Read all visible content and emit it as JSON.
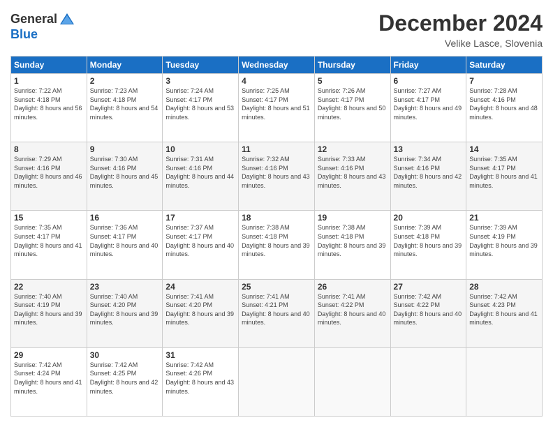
{
  "logo": {
    "general": "General",
    "blue": "Blue"
  },
  "header": {
    "month": "December 2024",
    "location": "Velike Lasce, Slovenia"
  },
  "weekdays": [
    "Sunday",
    "Monday",
    "Tuesday",
    "Wednesday",
    "Thursday",
    "Friday",
    "Saturday"
  ],
  "weeks": [
    [
      {
        "day": "1",
        "info": "Sunrise: 7:22 AM\nSunset: 4:18 PM\nDaylight: 8 hours and 56 minutes."
      },
      {
        "day": "2",
        "info": "Sunrise: 7:23 AM\nSunset: 4:18 PM\nDaylight: 8 hours and 54 minutes."
      },
      {
        "day": "3",
        "info": "Sunrise: 7:24 AM\nSunset: 4:17 PM\nDaylight: 8 hours and 53 minutes."
      },
      {
        "day": "4",
        "info": "Sunrise: 7:25 AM\nSunset: 4:17 PM\nDaylight: 8 hours and 51 minutes."
      },
      {
        "day": "5",
        "info": "Sunrise: 7:26 AM\nSunset: 4:17 PM\nDaylight: 8 hours and 50 minutes."
      },
      {
        "day": "6",
        "info": "Sunrise: 7:27 AM\nSunset: 4:17 PM\nDaylight: 8 hours and 49 minutes."
      },
      {
        "day": "7",
        "info": "Sunrise: 7:28 AM\nSunset: 4:16 PM\nDaylight: 8 hours and 48 minutes."
      }
    ],
    [
      {
        "day": "8",
        "info": "Sunrise: 7:29 AM\nSunset: 4:16 PM\nDaylight: 8 hours and 46 minutes."
      },
      {
        "day": "9",
        "info": "Sunrise: 7:30 AM\nSunset: 4:16 PM\nDaylight: 8 hours and 45 minutes."
      },
      {
        "day": "10",
        "info": "Sunrise: 7:31 AM\nSunset: 4:16 PM\nDaylight: 8 hours and 44 minutes."
      },
      {
        "day": "11",
        "info": "Sunrise: 7:32 AM\nSunset: 4:16 PM\nDaylight: 8 hours and 43 minutes."
      },
      {
        "day": "12",
        "info": "Sunrise: 7:33 AM\nSunset: 4:16 PM\nDaylight: 8 hours and 43 minutes."
      },
      {
        "day": "13",
        "info": "Sunrise: 7:34 AM\nSunset: 4:16 PM\nDaylight: 8 hours and 42 minutes."
      },
      {
        "day": "14",
        "info": "Sunrise: 7:35 AM\nSunset: 4:17 PM\nDaylight: 8 hours and 41 minutes."
      }
    ],
    [
      {
        "day": "15",
        "info": "Sunrise: 7:35 AM\nSunset: 4:17 PM\nDaylight: 8 hours and 41 minutes."
      },
      {
        "day": "16",
        "info": "Sunrise: 7:36 AM\nSunset: 4:17 PM\nDaylight: 8 hours and 40 minutes."
      },
      {
        "day": "17",
        "info": "Sunrise: 7:37 AM\nSunset: 4:17 PM\nDaylight: 8 hours and 40 minutes."
      },
      {
        "day": "18",
        "info": "Sunrise: 7:38 AM\nSunset: 4:18 PM\nDaylight: 8 hours and 39 minutes."
      },
      {
        "day": "19",
        "info": "Sunrise: 7:38 AM\nSunset: 4:18 PM\nDaylight: 8 hours and 39 minutes."
      },
      {
        "day": "20",
        "info": "Sunrise: 7:39 AM\nSunset: 4:18 PM\nDaylight: 8 hours and 39 minutes."
      },
      {
        "day": "21",
        "info": "Sunrise: 7:39 AM\nSunset: 4:19 PM\nDaylight: 8 hours and 39 minutes."
      }
    ],
    [
      {
        "day": "22",
        "info": "Sunrise: 7:40 AM\nSunset: 4:19 PM\nDaylight: 8 hours and 39 minutes."
      },
      {
        "day": "23",
        "info": "Sunrise: 7:40 AM\nSunset: 4:20 PM\nDaylight: 8 hours and 39 minutes."
      },
      {
        "day": "24",
        "info": "Sunrise: 7:41 AM\nSunset: 4:20 PM\nDaylight: 8 hours and 39 minutes."
      },
      {
        "day": "25",
        "info": "Sunrise: 7:41 AM\nSunset: 4:21 PM\nDaylight: 8 hours and 40 minutes."
      },
      {
        "day": "26",
        "info": "Sunrise: 7:41 AM\nSunset: 4:22 PM\nDaylight: 8 hours and 40 minutes."
      },
      {
        "day": "27",
        "info": "Sunrise: 7:42 AM\nSunset: 4:22 PM\nDaylight: 8 hours and 40 minutes."
      },
      {
        "day": "28",
        "info": "Sunrise: 7:42 AM\nSunset: 4:23 PM\nDaylight: 8 hours and 41 minutes."
      }
    ],
    [
      {
        "day": "29",
        "info": "Sunrise: 7:42 AM\nSunset: 4:24 PM\nDaylight: 8 hours and 41 minutes."
      },
      {
        "day": "30",
        "info": "Sunrise: 7:42 AM\nSunset: 4:25 PM\nDaylight: 8 hours and 42 minutes."
      },
      {
        "day": "31",
        "info": "Sunrise: 7:42 AM\nSunset: 4:26 PM\nDaylight: 8 hours and 43 minutes."
      },
      null,
      null,
      null,
      null
    ]
  ]
}
